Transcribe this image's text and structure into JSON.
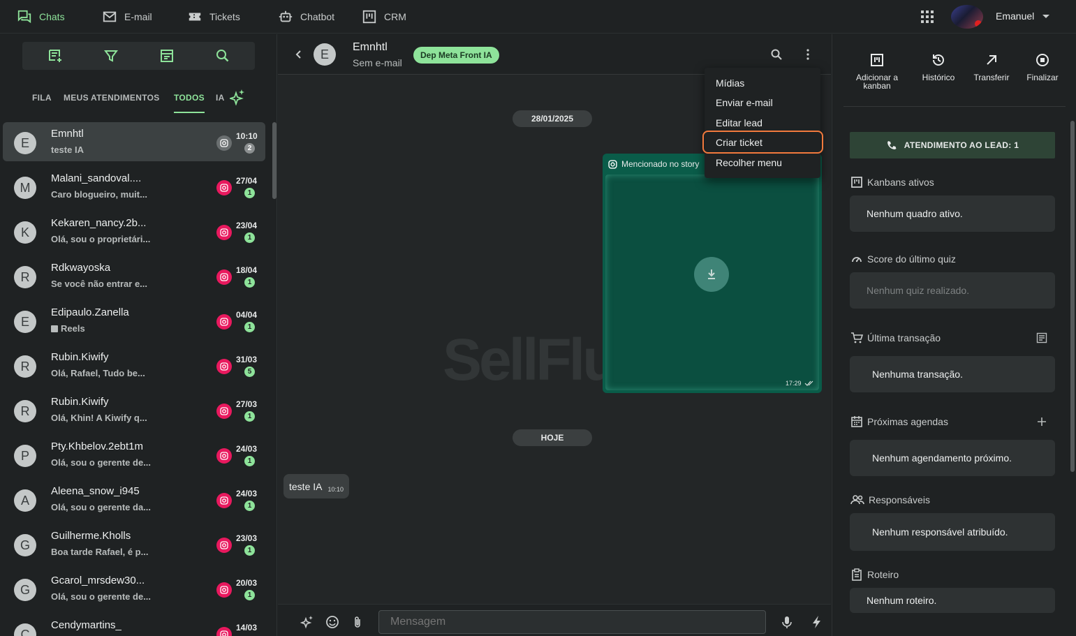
{
  "nav": {
    "items": [
      {
        "label": "Chats",
        "icon": "chats-icon",
        "active": true
      },
      {
        "label": "E-mail",
        "icon": "mail-icon"
      },
      {
        "label": "Tickets",
        "icon": "ticket-icon"
      },
      {
        "label": "Chatbot",
        "icon": "robot-icon"
      },
      {
        "label": "CRM",
        "icon": "kanban-icon"
      }
    ],
    "user_name": "Emanuel"
  },
  "left": {
    "tabs": [
      "FILA",
      "MEUS ATENDIMENTOS",
      "TODOS",
      "IA"
    ],
    "active_tab": "TODOS",
    "chats": [
      {
        "initial": "E",
        "name": "Emnhtl",
        "preview": "teste IA",
        "time": "10:10",
        "count": "2",
        "selected": true
      },
      {
        "initial": "M",
        "name": "Malani_sandoval....",
        "preview": "Caro blogueiro, muit...",
        "time": "27/04",
        "count": "1"
      },
      {
        "initial": "K",
        "name": "Kekaren_nancy.2b...",
        "preview": "Olá, sou o proprietári...",
        "time": "23/04",
        "count": "1"
      },
      {
        "initial": "R",
        "name": "Rdkwayoska",
        "preview": "Se você não entrar e...",
        "time": "18/04",
        "count": "1"
      },
      {
        "initial": "E",
        "name": "Edipaulo.Zanella",
        "preview": "Reels",
        "time": "04/04",
        "count": "1",
        "preview_icon": "reels-icon"
      },
      {
        "initial": "R",
        "name": "Rubin.Kiwify",
        "preview": "Olá, Rafael, Tudo be...",
        "time": "31/03",
        "count": "5"
      },
      {
        "initial": "R",
        "name": "Rubin.Kiwify",
        "preview": "Olá, Khin! A Kiwify q...",
        "time": "27/03",
        "count": "1"
      },
      {
        "initial": "P",
        "name": "Pty.Khbelov.2ebt1m",
        "preview": "Olá, sou o gerente de...",
        "time": "24/03",
        "count": "1"
      },
      {
        "initial": "A",
        "name": "Aleena_snow_i945",
        "preview": "Olá, sou o gerente da...",
        "time": "24/03",
        "count": "1"
      },
      {
        "initial": "G",
        "name": "Guilherme.Kholls",
        "preview": "Boa tarde Rafael, é p...",
        "time": "23/03",
        "count": "1"
      },
      {
        "initial": "G",
        "name": "Gcarol_mrsdew30...",
        "preview": "Olá, sou o gerente de...",
        "time": "20/03",
        "count": "1"
      },
      {
        "initial": "C",
        "name": "Cendymartins_",
        "preview": "",
        "time": "14/03",
        "count": ""
      }
    ]
  },
  "chat": {
    "contact_initial": "E",
    "contact_name": "Emnhtl",
    "contact_sub": "Sem e-mail",
    "dept": "Dep Meta Front IA",
    "watermark": "SellFlux",
    "date_1": "28/01/2025",
    "story_label": "Mencionado no story",
    "story_time": "17:29",
    "date_2": "HOJE",
    "message_text": "teste IA",
    "message_time": "10:10",
    "composer_placeholder": "Mensagem"
  },
  "menu": {
    "items": [
      "Mídias",
      "Enviar e-mail",
      "Editar lead",
      "Criar ticket",
      "Recolher menu"
    ],
    "highlighted": "Criar ticket"
  },
  "right": {
    "actions": [
      {
        "label": "Adicionar a kanban",
        "icon": "kanban-icon"
      },
      {
        "label": "Histórico",
        "icon": "history-icon"
      },
      {
        "label": "Transferir",
        "icon": "arrow-up-right-icon"
      },
      {
        "label": "Finalizar",
        "icon": "stop-circle-icon"
      }
    ],
    "lead_button": "ATENDIMENTO AO LEAD: 1",
    "sections": [
      {
        "title": "Kanbans ativos",
        "icon": "kanban-icon",
        "body": "Nenhum quadro ativo."
      },
      {
        "title": "Score do último quiz",
        "icon": "gauge-icon",
        "body": "Nenhum quiz realizado.",
        "muted": true
      },
      {
        "title": "Última transação",
        "icon": "cart-icon",
        "body": "Nenhuma transação.",
        "action_icon": "receipt-icon"
      },
      {
        "title": "Próximas agendas",
        "icon": "calendar-icon",
        "body": "Nenhum agendamento próximo.",
        "action_icon": "plus-icon"
      },
      {
        "title": "Responsáveis",
        "icon": "people-icon",
        "body": "Nenhum responsável atribuído."
      },
      {
        "title": "Roteiro",
        "icon": "clipboard-icon",
        "body": "Nenhum roteiro."
      }
    ]
  },
  "colors": {
    "accent": "#8ee39a",
    "instagram": "#e8195e",
    "story_bg": "#0a5c49",
    "highlight_border": "#f27a3d"
  }
}
